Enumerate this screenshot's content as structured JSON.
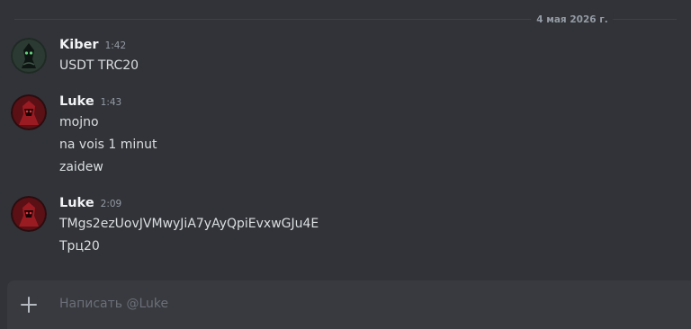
{
  "date_divider": "4 мая 2026 г.",
  "messages": [
    {
      "author": "Kiber",
      "time": "1:42",
      "lines": [
        "USDT TRC20"
      ]
    },
    {
      "author": "Luke",
      "time": "1:43",
      "lines": [
        "mojno",
        "na vois 1 minut",
        "zaidew"
      ]
    },
    {
      "author": "Luke",
      "time": "2:09",
      "lines": [
        "TMgs2ezUovJVMwyJiA7yAyQpiEvxwGJu4E",
        "Трц20"
      ]
    }
  ],
  "composer": {
    "placeholder": "Написать @Luke"
  },
  "colors": {
    "background": "#313338",
    "composer": "#383a40",
    "muted": "#949ba4",
    "username": "#f2f3f5"
  }
}
